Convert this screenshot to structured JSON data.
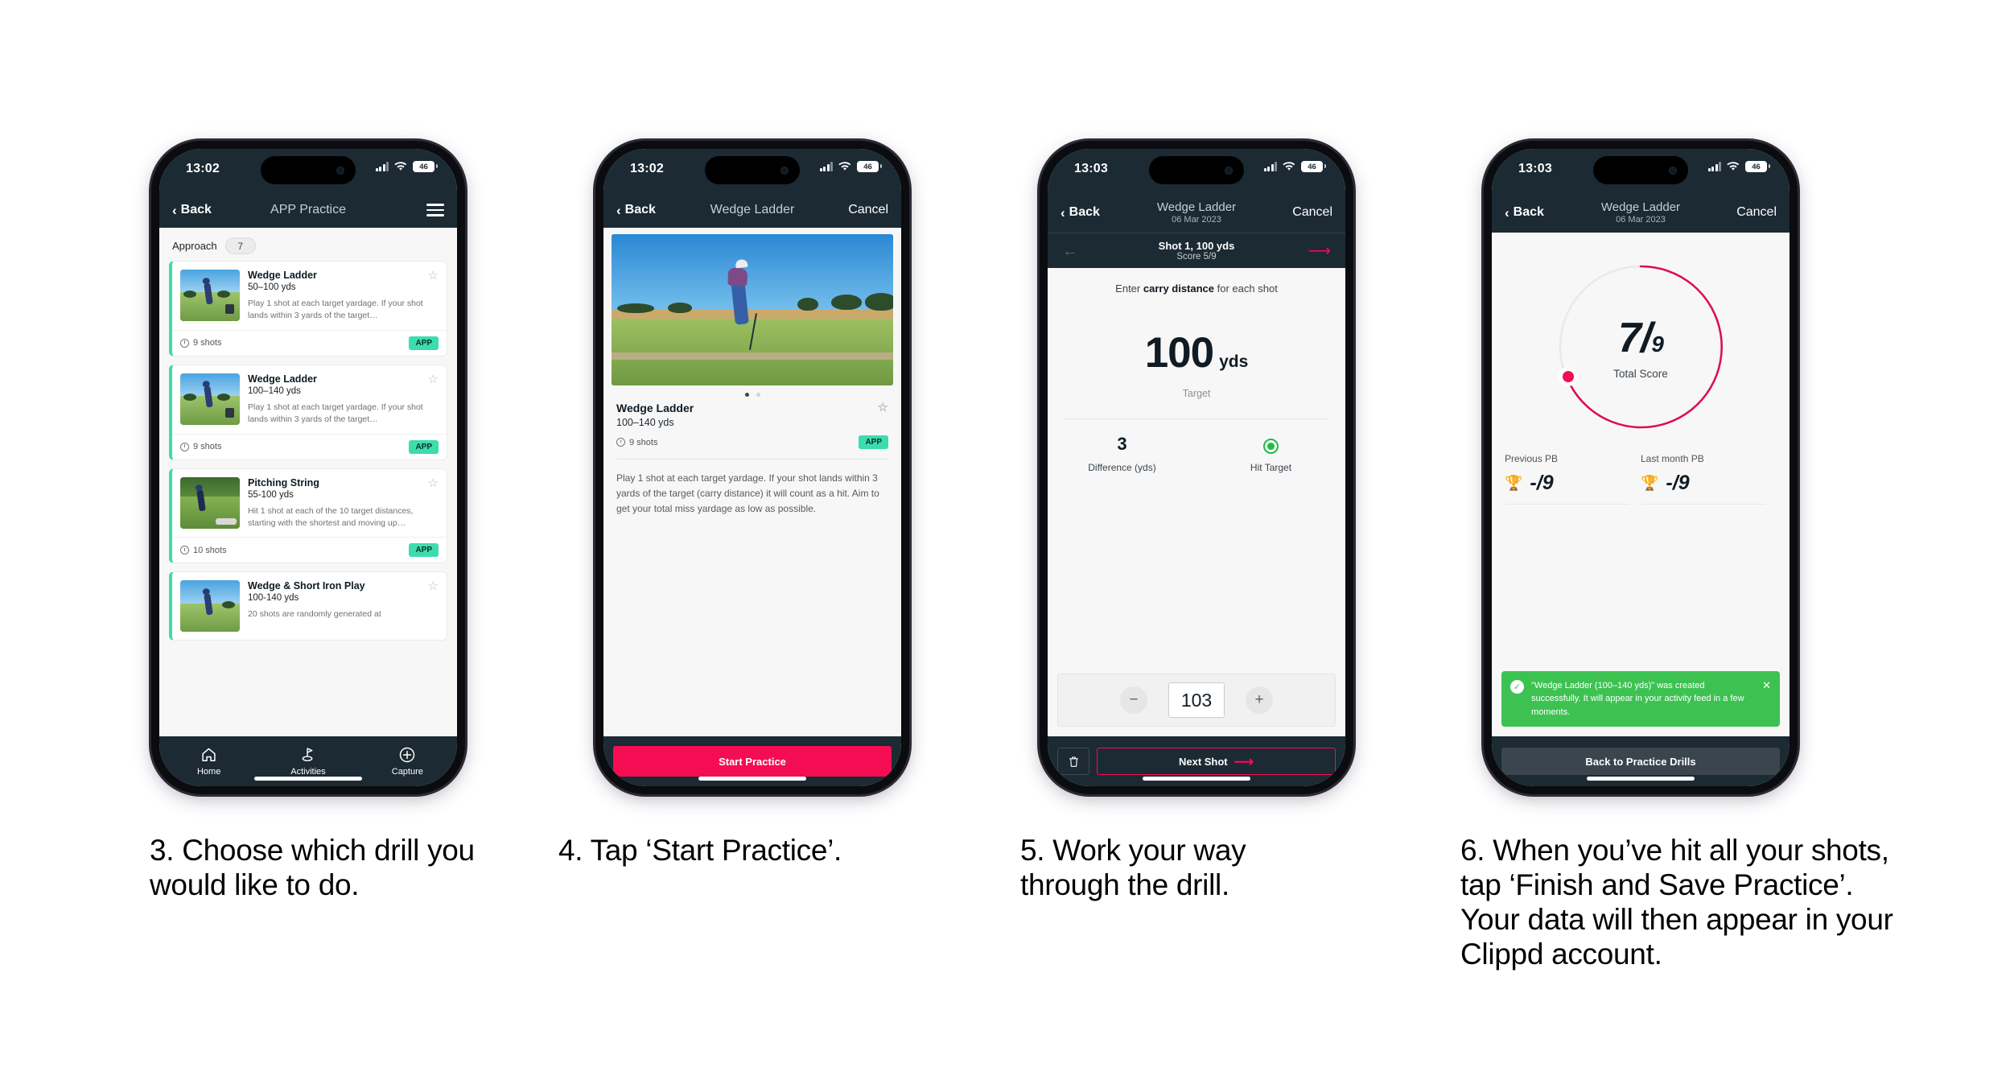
{
  "phones": [
    {
      "status": {
        "time": "13:02",
        "battery": "46"
      },
      "nav": {
        "back": "Back",
        "title": "APP Practice",
        "menu_icon": "hamburger-icon"
      },
      "section": {
        "label": "Approach",
        "count": "7"
      },
      "cards": [
        {
          "title": "Wedge Ladder",
          "sub": "50–100 yds",
          "desc": "Play 1 shot at each target yardage. If your shot lands within 3 yards of the target…",
          "shots": "9 shots",
          "tag": "APP"
        },
        {
          "title": "Wedge Ladder",
          "sub": "100–140 yds",
          "desc": "Play 1 shot at each target yardage. If your shot lands within 3 yards of the target…",
          "shots": "9 shots",
          "tag": "APP"
        },
        {
          "title": "Pitching String",
          "sub": "55-100 yds",
          "desc": "Hit 1 shot at each of the 10 target distances, starting with the shortest and moving up…",
          "shots": "10 shots",
          "tag": "APP"
        },
        {
          "title": "Wedge & Short Iron Play",
          "sub": "100-140 yds",
          "desc": "20 shots are randomly generated at",
          "shots": "",
          "tag": ""
        }
      ],
      "tabs": [
        {
          "label": "Home",
          "icon": "home-icon"
        },
        {
          "label": "Activities",
          "icon": "golf-flag-icon"
        },
        {
          "label": "Capture",
          "icon": "plus-circle-icon"
        }
      ]
    },
    {
      "status": {
        "time": "13:02",
        "battery": "46"
      },
      "nav": {
        "back": "Back",
        "title": "Wedge Ladder",
        "cancel": "Cancel"
      },
      "detail": {
        "title": "Wedge Ladder",
        "sub": "100–140 yds",
        "shots": "9 shots",
        "tag": "APP",
        "description": "Play 1 shot at each target yardage. If your shot lands within 3 yards of the target (carry distance) it will count as a hit. Aim to get your total miss yardage as low as possible.",
        "cta": "Start Practice"
      }
    },
    {
      "status": {
        "time": "13:03",
        "battery": "46"
      },
      "nav": {
        "back": "Back",
        "title": "Wedge Ladder",
        "subtitle": "06 Mar 2023",
        "cancel": "Cancel"
      },
      "shotbar": {
        "title": "Shot 1, 100 yds",
        "score": "Score 5/9",
        "prev_icon": "arrow-left-icon",
        "next_icon": "arrow-right-icon"
      },
      "entry": {
        "prompt_pre": "Enter ",
        "prompt_bold": "carry distance",
        "prompt_post": " for each shot",
        "target_value": "100",
        "target_unit": "yds",
        "target_label": "Target",
        "difference_value": "3",
        "difference_label": "Difference (yds)",
        "hit_label": "Hit Target",
        "hit_icon": "target-hit-icon",
        "stepper_value": "103",
        "minus": "−",
        "plus": "+",
        "delete_icon": "trash-icon",
        "next_label": "Next Shot"
      }
    },
    {
      "status": {
        "time": "13:03",
        "battery": "46"
      },
      "nav": {
        "back": "Back",
        "title": "Wedge Ladder",
        "subtitle": "06 Mar 2023",
        "cancel": "Cancel"
      },
      "result": {
        "score_num": "7",
        "score_sep": "/",
        "score_den": "9",
        "score_label": "Total Score",
        "pbs": [
          {
            "label": "Previous PB",
            "value": "-/9",
            "icon": "trophy-icon"
          },
          {
            "label": "Last month PB",
            "value": "-/9",
            "icon": "trophy-icon"
          }
        ],
        "toast": {
          "message": "\"Wedge Ladder (100–140 yds)\" was created successfully. It will appear in your activity feed in a few moments.",
          "check_icon": "check-circle-icon",
          "close_icon": "close-icon"
        },
        "button": "Back to Practice Drills"
      }
    }
  ],
  "captions": [
    "3. Choose which drill you would like to do.",
    "4. Tap ‘Start Practice’.",
    "5. Work your way through the drill.",
    "6. When you’ve hit all your shots, tap ‘Finish and Save Practice’. Your data will then appear in your Clippd account."
  ],
  "colors": {
    "accent_pink": "#f50d53",
    "teal": "#3ddcae",
    "navy": "#1b2a33",
    "green": "#3dc252"
  }
}
